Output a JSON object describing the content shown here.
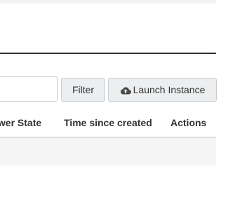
{
  "toolbar": {
    "filter_input_value": "",
    "filter_label": "Filter",
    "launch_label": "Launch Instance",
    "launch_icon": "cloud-upload-icon"
  },
  "table": {
    "columns": [
      "Power State",
      "Time since created",
      "Actions"
    ],
    "rows": []
  }
}
